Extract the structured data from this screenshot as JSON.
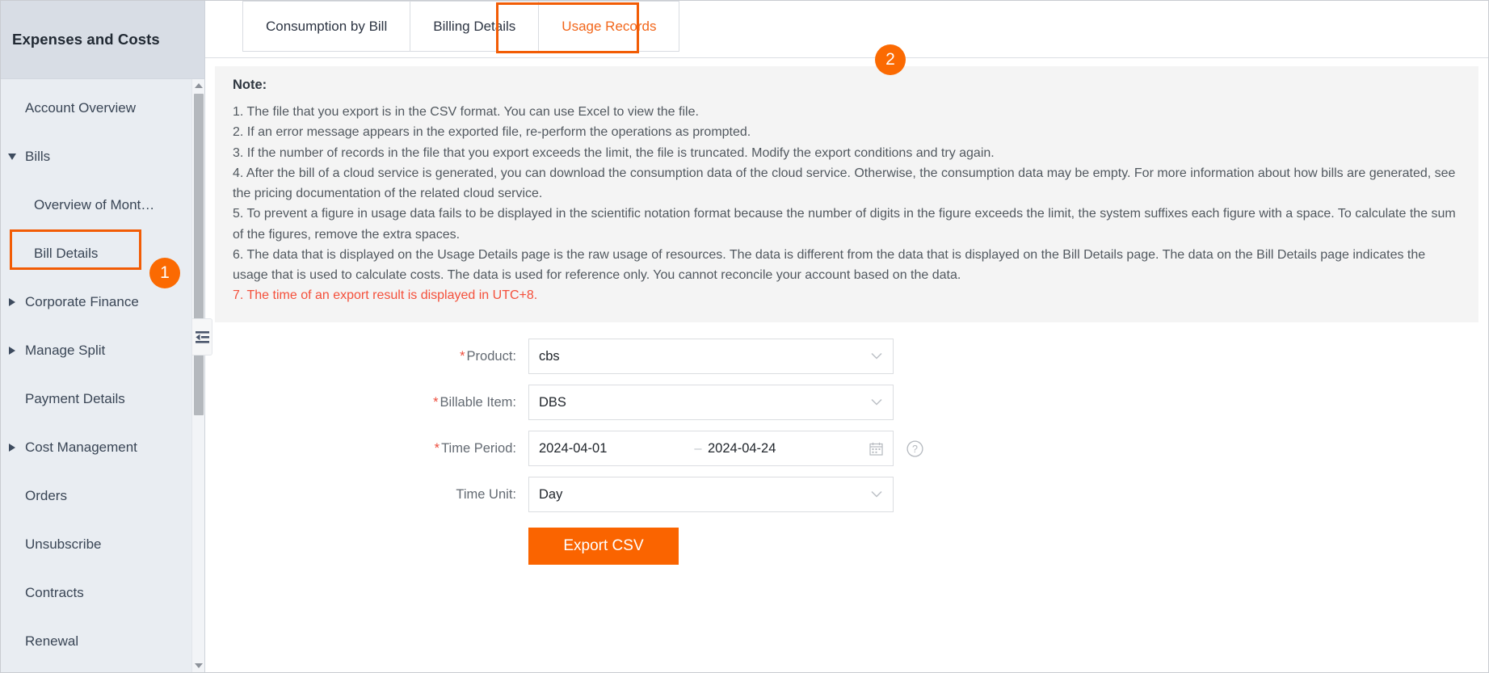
{
  "sidebar": {
    "title": "Expenses and Costs",
    "items": [
      {
        "label": "Account Overview",
        "caret": "none",
        "level": 0
      },
      {
        "label": "Bills",
        "caret": "down",
        "level": 0
      },
      {
        "label": "Overview of Mont…",
        "caret": "none",
        "level": 1
      },
      {
        "label": "Bill Details",
        "caret": "none",
        "level": 1
      },
      {
        "label": "Corporate Finance",
        "caret": "right",
        "level": 0
      },
      {
        "label": "Manage Split",
        "caret": "right",
        "level": 0
      },
      {
        "label": "Payment Details",
        "caret": "none",
        "level": 0
      },
      {
        "label": "Cost Management",
        "caret": "right",
        "level": 0
      },
      {
        "label": "Orders",
        "caret": "none",
        "level": 0
      },
      {
        "label": "Unsubscribe",
        "caret": "none",
        "level": 0
      },
      {
        "label": "Contracts",
        "caret": "none",
        "level": 0
      },
      {
        "label": "Renewal",
        "caret": "none",
        "level": 0
      }
    ],
    "collapse_icon": "collapse-sidebar-icon"
  },
  "annotations": {
    "badge_1": "1",
    "badge_2": "2",
    "color": "#f25c05"
  },
  "tabs": [
    {
      "label": "Consumption by Bill",
      "active": false
    },
    {
      "label": "Billing Details",
      "active": false
    },
    {
      "label": "Usage Records",
      "active": true
    }
  ],
  "note": {
    "title": "Note:",
    "lines": [
      "1. The file that you export is in the CSV format. You can use Excel to view the file.",
      "2. If an error message appears in the exported file, re-perform the operations as prompted.",
      "3. If the number of records in the file that you export exceeds the limit, the file is truncated. Modify the export conditions and try again.",
      "4. After the bill of a cloud service is generated, you can download the consumption data of the cloud service. Otherwise, the consumption data may be empty. For more information about how bills are generated, see the pricing documentation of the related cloud service.",
      "5. To prevent a figure in usage data fails to be displayed in the scientific notation format because the number of digits in the figure exceeds the limit, the system suffixes each figure with a space. To calculate the sum of the figures, remove the extra spaces.",
      "6. The data that is displayed on the Usage Details page is the raw usage of resources. The data is different from the data that is displayed on the Bill Details page. The data on the Bill Details page indicates the usage that is used to calculate costs. The data is used for reference only. You cannot reconcile your account based on the data."
    ],
    "warning_line": "7. The time of an export result is displayed in UTC+8.",
    "warning_color": "#f4503b"
  },
  "form": {
    "product": {
      "label": "Product:",
      "required": true,
      "value": "cbs"
    },
    "billable_item": {
      "label": "Billable Item:",
      "required": true,
      "value": "DBS"
    },
    "time_period": {
      "label": "Time Period:",
      "required": true,
      "start": "2024-04-01",
      "separator": "–",
      "end": "2024-04-24",
      "calendar_icon": "calendar-icon",
      "help_icon": "question-mark-icon"
    },
    "time_unit": {
      "label": "Time Unit:",
      "required": false,
      "value": "Day"
    },
    "export_button": "Export CSV",
    "export_button_color": "#fa6400"
  }
}
